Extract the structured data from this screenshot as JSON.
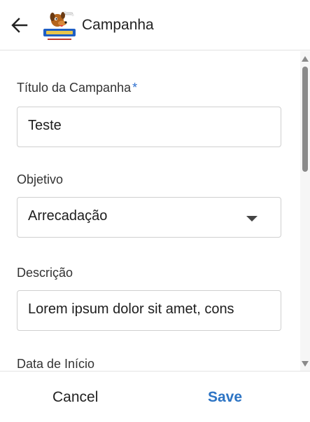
{
  "header": {
    "title": "Campanha",
    "back_icon": "arrow-left-icon",
    "logo_icon": "bicho-loka-logo"
  },
  "form": {
    "titulo": {
      "label": "Título da Campanha",
      "required_mark": "*",
      "value": "Teste"
    },
    "objetivo": {
      "label": "Objetivo",
      "value": "Arrecadação",
      "icon": "dropdown-caret-icon"
    },
    "descricao": {
      "label": "Descrição",
      "value": "Lorem ipsum dolor sit amet, cons"
    },
    "data_inicio": {
      "label": "Data de Início"
    }
  },
  "footer": {
    "cancel_label": "Cancel",
    "save_label": "Save"
  },
  "colors": {
    "accent": "#2d74c4",
    "required": "#2d6fcf",
    "border": "#cfcfcf"
  }
}
